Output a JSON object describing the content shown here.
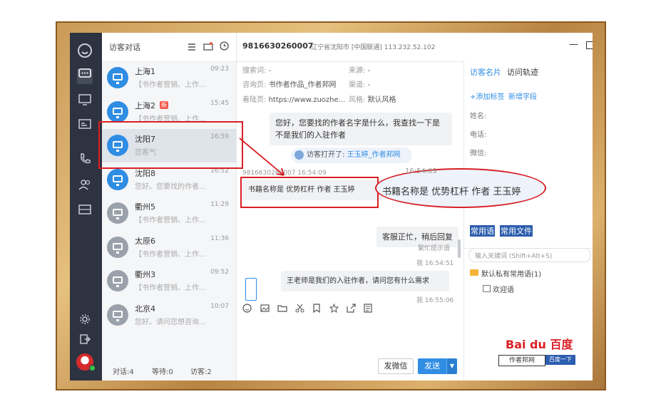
{
  "sidebar": {
    "icons": [
      "smiley-logo-icon",
      "chat-icon",
      "monitor-icon",
      "card-icon",
      "phone-icon",
      "users-icon",
      "ticket-icon",
      "gear-icon",
      "exit-icon",
      "avatar"
    ]
  },
  "conv_list": {
    "title": "访客对话",
    "items": [
      {
        "name": "上海1",
        "time": "09:23",
        "sub": "【书作者营销、上作...",
        "avatar": "blue"
      },
      {
        "name": "上海2",
        "time": "15:45",
        "sub": "【书作者营销、上作...",
        "avatar": "blue",
        "badge": "新"
      },
      {
        "name": "沈阳7",
        "time": "16:59",
        "sub": "您客气",
        "avatar": "blue"
      },
      {
        "name": "沈阳8",
        "time": "16:52",
        "sub": "您好。您要找的作者...",
        "avatar": "blue"
      },
      {
        "name": "衢州5",
        "time": "11:29",
        "sub": "【书作者营销、上作...",
        "avatar": "gray"
      },
      {
        "name": "太原6",
        "time": "11:36",
        "sub": "【书作者营销、上作...",
        "avatar": "gray"
      },
      {
        "name": "衢州3",
        "time": "09:52",
        "sub": "【书作者营销、上作...",
        "avatar": "gray"
      },
      {
        "name": "北京4",
        "time": "10:07",
        "sub": "您好。请问您想咨询...",
        "avatar": "gray"
      }
    ],
    "status": {
      "talk": "对话:4",
      "wait": "等待:0",
      "visitor": "访客:2"
    }
  },
  "header": {
    "visitor_id": "9816630260007",
    "location": "辽宁省沈阳市 [中国联通]  113.232.52.102",
    "minimize": "—"
  },
  "meta": {
    "keyword_label": "搜索词:",
    "keyword": "-",
    "source_label": "来源:",
    "source": "-",
    "page_label": "咨询页:",
    "page": "书作者作品_作者邦网",
    "channel_label": "渠道:",
    "channel": "-",
    "landing_label": "着陆页:",
    "landing": "https://www.zuozhe...",
    "style_label": "风格:",
    "style": "默认风格"
  },
  "messages": {
    "agent1": "您好，您要找的作者名字是什么，我查找一下是不是我们的入驻作者",
    "opened_label": "访客打开了:",
    "opened_link": "王玉婷_作者邦网",
    "visitor_header": "9816630260007 16:54:09",
    "visitor_msg": "书籍名称是 优势杠杆   作者  王玉婷",
    "zoom_time": "16:54:09",
    "zoom_msg": "书籍名称是 优势杠杆   作者  王玉婷",
    "busy_msg": "客服正忙，稍后回复",
    "busy_note": "繁忙提示语",
    "me_time1": "我  16:54:51",
    "agent2": "王老师是我们的入驻作者，请问您有什么需求",
    "me_time2": "我  16:55:06"
  },
  "composer": {
    "tools": [
      "emoji-icon",
      "image-icon",
      "folder-icon",
      "scissors-icon",
      "bookmark-icon",
      "star-icon",
      "share-icon",
      "doc-icon"
    ],
    "wechat_btn": "发微信",
    "send_btn": "发送"
  },
  "right": {
    "tab1": "访客名片",
    "tab2": "访问轨迹",
    "add_tag": "+添加标签",
    "add_field": "新增字段",
    "name_label": "姓名:",
    "phone_label": "电话:",
    "wechat_label": "微信:",
    "tab3": "常用语",
    "tab4": "常用文件",
    "search_placeholder": "输入关键词 (Shift+Alt+S)",
    "folder": "默认私有常用语(1)",
    "phrase": "欢迎语"
  },
  "watermark": {
    "brand": "Bai du 百度",
    "left": "作者邦网",
    "right": "百度一下"
  },
  "colors": {
    "accent": "#2f8de4",
    "annotation": "#d91f26",
    "rail": "#2d3340"
  }
}
